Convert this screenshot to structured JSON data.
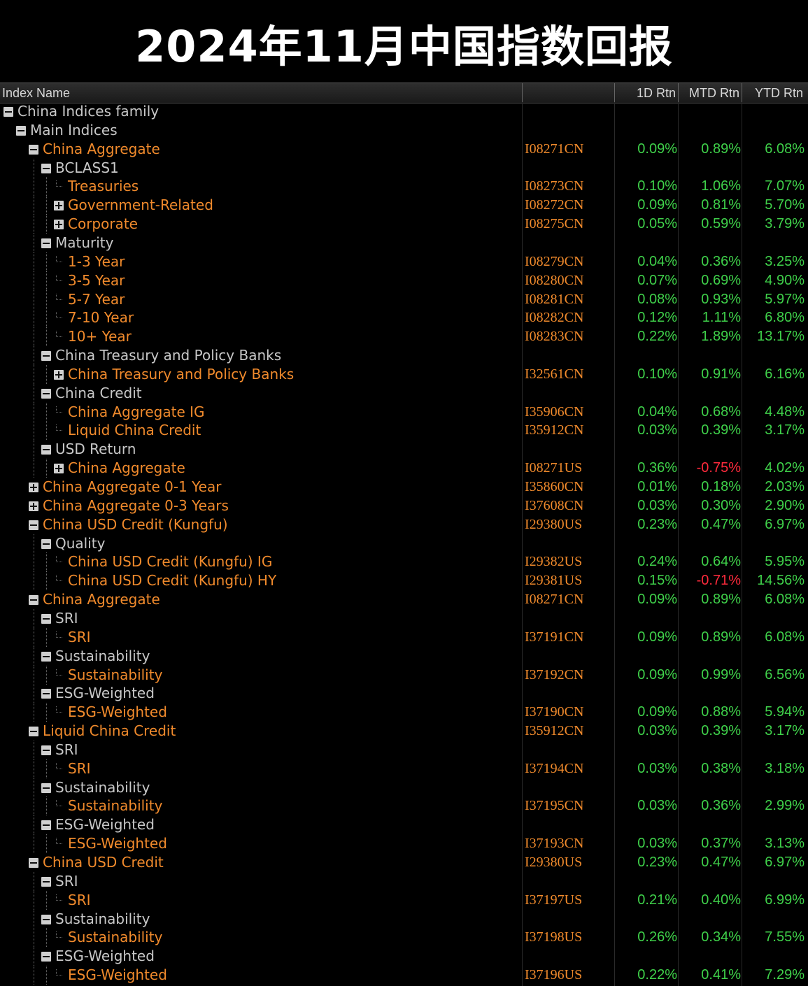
{
  "banner": {
    "title": "2024年11月中国指数回报"
  },
  "columns": {
    "index_name": "Index Name",
    "ticker": "",
    "d1": "1D Rtn",
    "mtd": "MTD Rtn",
    "ytd": "YTD Rtn"
  },
  "colors": {
    "positive": "#3fd14a",
    "negative": "#ff2a3c",
    "index_label": "#f08a2c",
    "group_label": "#c8c8c8"
  },
  "rows": [
    {
      "depth": 0,
      "label": "China Indices family",
      "kind": "group",
      "toggle": "minus",
      "ticker": "",
      "d1": "",
      "mtd": "",
      "ytd": ""
    },
    {
      "depth": 1,
      "label": "Main Indices",
      "kind": "group",
      "toggle": "minus",
      "ticker": "",
      "d1": "",
      "mtd": "",
      "ytd": ""
    },
    {
      "depth": 2,
      "label": "China Aggregate",
      "kind": "index",
      "toggle": "minus",
      "ticker": "I08271CN",
      "d1": "0.09%",
      "mtd": "0.89%",
      "ytd": "6.08%"
    },
    {
      "depth": 3,
      "label": "BCLASS1",
      "kind": "group",
      "toggle": "minus",
      "ticker": "",
      "d1": "",
      "mtd": "",
      "ytd": ""
    },
    {
      "depth": 4,
      "label": "Treasuries",
      "kind": "index",
      "toggle": "leaf",
      "ticker": "I08273CN",
      "d1": "0.10%",
      "mtd": "1.06%",
      "ytd": "7.07%"
    },
    {
      "depth": 4,
      "label": "Government-Related",
      "kind": "index",
      "toggle": "plus",
      "ticker": "I08272CN",
      "d1": "0.09%",
      "mtd": "0.81%",
      "ytd": "5.70%"
    },
    {
      "depth": 4,
      "label": "Corporate",
      "kind": "index",
      "toggle": "plus",
      "ticker": "I08275CN",
      "d1": "0.05%",
      "mtd": "0.59%",
      "ytd": "3.79%"
    },
    {
      "depth": 3,
      "label": "Maturity",
      "kind": "group",
      "toggle": "minus",
      "ticker": "",
      "d1": "",
      "mtd": "",
      "ytd": ""
    },
    {
      "depth": 4,
      "label": "1-3 Year",
      "kind": "index",
      "toggle": "leaf",
      "ticker": "I08279CN",
      "d1": "0.04%",
      "mtd": "0.36%",
      "ytd": "3.25%"
    },
    {
      "depth": 4,
      "label": "3-5 Year",
      "kind": "index",
      "toggle": "leaf",
      "ticker": "I08280CN",
      "d1": "0.07%",
      "mtd": "0.69%",
      "ytd": "4.90%"
    },
    {
      "depth": 4,
      "label": "5-7 Year",
      "kind": "index",
      "toggle": "leaf",
      "ticker": "I08281CN",
      "d1": "0.08%",
      "mtd": "0.93%",
      "ytd": "5.97%"
    },
    {
      "depth": 4,
      "label": "7-10 Year",
      "kind": "index",
      "toggle": "leaf",
      "ticker": "I08282CN",
      "d1": "0.12%",
      "mtd": "1.11%",
      "ytd": "6.80%"
    },
    {
      "depth": 4,
      "label": "10+ Year",
      "kind": "index",
      "toggle": "leaf",
      "ticker": "I08283CN",
      "d1": "0.22%",
      "mtd": "1.89%",
      "ytd": "13.17%"
    },
    {
      "depth": 3,
      "label": "China Treasury and Policy Banks",
      "kind": "group",
      "toggle": "minus",
      "ticker": "",
      "d1": "",
      "mtd": "",
      "ytd": ""
    },
    {
      "depth": 4,
      "label": "China Treasury and Policy Banks",
      "kind": "index",
      "toggle": "plus",
      "ticker": "I32561CN",
      "d1": "0.10%",
      "mtd": "0.91%",
      "ytd": "6.16%"
    },
    {
      "depth": 3,
      "label": "China Credit",
      "kind": "group",
      "toggle": "minus",
      "ticker": "",
      "d1": "",
      "mtd": "",
      "ytd": ""
    },
    {
      "depth": 4,
      "label": "China Aggregate IG",
      "kind": "index",
      "toggle": "leaf",
      "ticker": "I35906CN",
      "d1": "0.04%",
      "mtd": "0.68%",
      "ytd": "4.48%"
    },
    {
      "depth": 4,
      "label": "Liquid China Credit",
      "kind": "index",
      "toggle": "leaf",
      "ticker": "I35912CN",
      "d1": "0.03%",
      "mtd": "0.39%",
      "ytd": "3.17%"
    },
    {
      "depth": 3,
      "label": "USD Return",
      "kind": "group",
      "toggle": "minus",
      "ticker": "",
      "d1": "",
      "mtd": "",
      "ytd": ""
    },
    {
      "depth": 4,
      "label": "China Aggregate",
      "kind": "index",
      "toggle": "plus",
      "ticker": "I08271US",
      "d1": "0.36%",
      "mtd": "-0.75%",
      "ytd": "4.02%"
    },
    {
      "depth": 2,
      "label": "China Aggregate 0-1 Year",
      "kind": "index",
      "toggle": "plus",
      "ticker": "I35860CN",
      "d1": "0.01%",
      "mtd": "0.18%",
      "ytd": "2.03%"
    },
    {
      "depth": 2,
      "label": "China Aggregate 0-3 Years",
      "kind": "index",
      "toggle": "plus",
      "ticker": "I37608CN",
      "d1": "0.03%",
      "mtd": "0.30%",
      "ytd": "2.90%"
    },
    {
      "depth": 2,
      "label": "China USD Credit (Kungfu)",
      "kind": "index",
      "toggle": "minus",
      "ticker": "I29380US",
      "d1": "0.23%",
      "mtd": "0.47%",
      "ytd": "6.97%"
    },
    {
      "depth": 3,
      "label": "Quality",
      "kind": "group",
      "toggle": "minus",
      "ticker": "",
      "d1": "",
      "mtd": "",
      "ytd": ""
    },
    {
      "depth": 4,
      "label": "China USD Credit (Kungfu) IG",
      "kind": "index",
      "toggle": "leaf",
      "ticker": "I29382US",
      "d1": "0.24%",
      "mtd": "0.64%",
      "ytd": "5.95%"
    },
    {
      "depth": 4,
      "label": "China USD Credit (Kungfu) HY",
      "kind": "index",
      "toggle": "leaf",
      "ticker": "I29381US",
      "d1": "0.15%",
      "mtd": "-0.71%",
      "ytd": "14.56%"
    },
    {
      "depth": 2,
      "label": "China Aggregate",
      "kind": "index",
      "toggle": "minus",
      "ticker": "I08271CN",
      "d1": "0.09%",
      "mtd": "0.89%",
      "ytd": "6.08%"
    },
    {
      "depth": 3,
      "label": "SRI",
      "kind": "group",
      "toggle": "minus",
      "ticker": "",
      "d1": "",
      "mtd": "",
      "ytd": ""
    },
    {
      "depth": 4,
      "label": "SRI",
      "kind": "index",
      "toggle": "leaf",
      "ticker": "I37191CN",
      "d1": "0.09%",
      "mtd": "0.89%",
      "ytd": "6.08%"
    },
    {
      "depth": 3,
      "label": "Sustainability",
      "kind": "group",
      "toggle": "minus",
      "ticker": "",
      "d1": "",
      "mtd": "",
      "ytd": ""
    },
    {
      "depth": 4,
      "label": "Sustainability",
      "kind": "index",
      "toggle": "leaf",
      "ticker": "I37192CN",
      "d1": "0.09%",
      "mtd": "0.99%",
      "ytd": "6.56%"
    },
    {
      "depth": 3,
      "label": "ESG-Weighted",
      "kind": "group",
      "toggle": "minus",
      "ticker": "",
      "d1": "",
      "mtd": "",
      "ytd": ""
    },
    {
      "depth": 4,
      "label": "ESG-Weighted",
      "kind": "index",
      "toggle": "leaf",
      "ticker": "I37190CN",
      "d1": "0.09%",
      "mtd": "0.88%",
      "ytd": "5.94%"
    },
    {
      "depth": 2,
      "label": "Liquid China Credit",
      "kind": "index",
      "toggle": "minus",
      "ticker": "I35912CN",
      "d1": "0.03%",
      "mtd": "0.39%",
      "ytd": "3.17%"
    },
    {
      "depth": 3,
      "label": "SRI",
      "kind": "group",
      "toggle": "minus",
      "ticker": "",
      "d1": "",
      "mtd": "",
      "ytd": ""
    },
    {
      "depth": 4,
      "label": "SRI",
      "kind": "index",
      "toggle": "leaf",
      "ticker": "I37194CN",
      "d1": "0.03%",
      "mtd": "0.38%",
      "ytd": "3.18%"
    },
    {
      "depth": 3,
      "label": "Sustainability",
      "kind": "group",
      "toggle": "minus",
      "ticker": "",
      "d1": "",
      "mtd": "",
      "ytd": ""
    },
    {
      "depth": 4,
      "label": "Sustainability",
      "kind": "index",
      "toggle": "leaf",
      "ticker": "I37195CN",
      "d1": "0.03%",
      "mtd": "0.36%",
      "ytd": "2.99%"
    },
    {
      "depth": 3,
      "label": "ESG-Weighted",
      "kind": "group",
      "toggle": "minus",
      "ticker": "",
      "d1": "",
      "mtd": "",
      "ytd": ""
    },
    {
      "depth": 4,
      "label": "ESG-Weighted",
      "kind": "index",
      "toggle": "leaf",
      "ticker": "I37193CN",
      "d1": "0.03%",
      "mtd": "0.37%",
      "ytd": "3.13%"
    },
    {
      "depth": 2,
      "label": "China USD Credit",
      "kind": "index",
      "toggle": "minus",
      "ticker": "I29380US",
      "d1": "0.23%",
      "mtd": "0.47%",
      "ytd": "6.97%"
    },
    {
      "depth": 3,
      "label": "SRI",
      "kind": "group",
      "toggle": "minus",
      "ticker": "",
      "d1": "",
      "mtd": "",
      "ytd": ""
    },
    {
      "depth": 4,
      "label": "SRI",
      "kind": "index",
      "toggle": "leaf",
      "ticker": "I37197US",
      "d1": "0.21%",
      "mtd": "0.40%",
      "ytd": "6.99%"
    },
    {
      "depth": 3,
      "label": "Sustainability",
      "kind": "group",
      "toggle": "minus",
      "ticker": "",
      "d1": "",
      "mtd": "",
      "ytd": ""
    },
    {
      "depth": 4,
      "label": "Sustainability",
      "kind": "index",
      "toggle": "leaf",
      "ticker": "I37198US",
      "d1": "0.26%",
      "mtd": "0.34%",
      "ytd": "7.55%"
    },
    {
      "depth": 3,
      "label": "ESG-Weighted",
      "kind": "group",
      "toggle": "minus",
      "ticker": "",
      "d1": "",
      "mtd": "",
      "ytd": ""
    },
    {
      "depth": 4,
      "label": "ESG-Weighted",
      "kind": "index",
      "toggle": "leaf",
      "ticker": "I37196US",
      "d1": "0.22%",
      "mtd": "0.41%",
      "ytd": "7.29%"
    }
  ]
}
